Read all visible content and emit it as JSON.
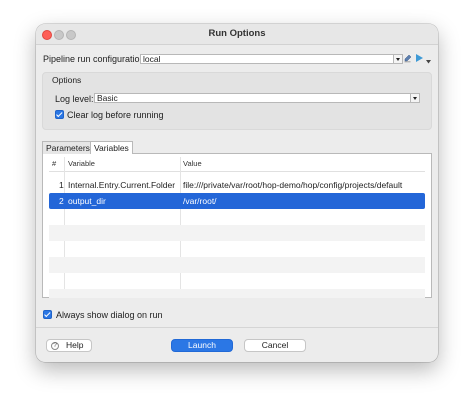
{
  "window": {
    "title": "Run Options"
  },
  "pipeline": {
    "label": "Pipeline run configuration",
    "value": "local"
  },
  "options": {
    "group_label": "Options",
    "log_level_label": "Log level:",
    "log_level_value": "Basic",
    "clear_log_label": "Clear log before running",
    "clear_log_checked": true
  },
  "tabs": [
    {
      "label": "Parameters",
      "active": false
    },
    {
      "label": "Variables",
      "active": true
    }
  ],
  "variables_table": {
    "columns": [
      "#",
      "Variable",
      "Value"
    ],
    "rows": [
      {
        "index": "1",
        "variable": "Internal.Entry.Current.Folder",
        "value": "file:///private/var/root/hop-demo/hop/config/projects/default"
      },
      {
        "index": "2",
        "variable": "output_dir",
        "value": "/var/root/",
        "selected": true
      }
    ]
  },
  "always_show": {
    "label": "Always show dialog on run",
    "checked": true
  },
  "buttons": {
    "help": "Help",
    "launch": "Launch",
    "cancel": "Cancel"
  },
  "colors": {
    "accent": "#2b77e5",
    "selection": "#2366d8",
    "close": "#fe5f57"
  }
}
